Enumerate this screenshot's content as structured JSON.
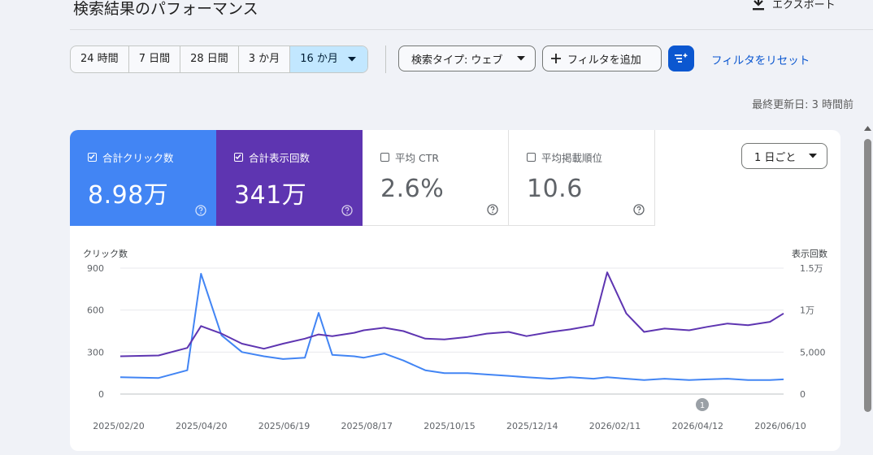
{
  "header": {
    "title": "検索結果のパフォーマンス",
    "export_label": "エクスポート"
  },
  "date_ranges": [
    {
      "label": "24 時間",
      "selected": false
    },
    {
      "label": "7 日間",
      "selected": false
    },
    {
      "label": "28 日間",
      "selected": false
    },
    {
      "label": "3 か月",
      "selected": false
    },
    {
      "label": "16 か月",
      "selected": true
    }
  ],
  "filters": {
    "search_type": "検索タイプ: ウェブ",
    "add_filter": "フィルタを追加",
    "reset": "フィルタをリセット"
  },
  "last_updated": "最終更新日: 3 時間前",
  "metrics": [
    {
      "label": "合計クリック数",
      "value": "8.98万",
      "checked": true,
      "color": "#4285f4"
    },
    {
      "label": "合計表示回数",
      "value": "341万",
      "checked": true,
      "color": "#5e35b1"
    },
    {
      "label": "平均 CTR",
      "value": "2.6%",
      "checked": false
    },
    {
      "label": "平均掲載順位",
      "value": "10.6",
      "checked": false
    }
  ],
  "granularity": "1 日ごと",
  "colors": {
    "accent": "#0b57d0",
    "clicks": "#4285f4",
    "impressions": "#5e35b1",
    "selected_range": "#c2e7ff"
  },
  "annotation_marker": "1",
  "chart_data": {
    "type": "line",
    "ylabel_left": "クリック数",
    "ylabel_right": "表示回数",
    "y_left_ticks": [
      "900",
      "600",
      "300",
      "0"
    ],
    "y_right_ticks": [
      "1.5万",
      "1万",
      "5,000",
      "0"
    ],
    "ylim_left": [
      0,
      900
    ],
    "ylim_right": [
      0,
      15000
    ],
    "x_tick_labels": [
      "2025/02/20",
      "2025/04/20",
      "2025/06/19",
      "2025/08/17",
      "2025/10/15",
      "2025/12/14",
      "2026/02/11",
      "2026/04/12",
      "2026/06/10"
    ],
    "x": [
      "2025/02/20",
      "2025/03/20",
      "2025/04/10",
      "2025/04/20",
      "2025/05/05",
      "2025/05/20",
      "2025/06/05",
      "2025/06/19",
      "2025/07/05",
      "2025/07/15",
      "2025/07/25",
      "2025/08/10",
      "2025/08/17",
      "2025/09/01",
      "2025/09/15",
      "2025/10/01",
      "2025/10/15",
      "2025/11/01",
      "2025/11/15",
      "2025/12/01",
      "2025/12/14",
      "2026/01/01",
      "2026/01/15",
      "2026/02/01",
      "2026/02/11",
      "2026/02/25",
      "2026/03/10",
      "2026/03/25",
      "2026/04/12",
      "2026/04/25",
      "2026/05/10",
      "2026/05/25",
      "2026/06/10",
      "2026/06/20"
    ],
    "series": [
      {
        "name": "合計クリック数",
        "axis": "left",
        "color": "#4285f4",
        "values": [
          120,
          115,
          170,
          860,
          420,
          300,
          270,
          250,
          260,
          580,
          280,
          270,
          260,
          290,
          240,
          170,
          150,
          150,
          140,
          130,
          120,
          110,
          120,
          110,
          120,
          110,
          100,
          110,
          100,
          105,
          110,
          100,
          100,
          105
        ]
      },
      {
        "name": "合計表示回数",
        "axis": "right",
        "color": "#5e35b1",
        "values": [
          4500,
          4600,
          5500,
          8100,
          7200,
          6000,
          5400,
          6000,
          6600,
          7100,
          6900,
          7300,
          7600,
          7900,
          7500,
          6600,
          6500,
          6800,
          7200,
          7400,
          6900,
          7400,
          7700,
          8200,
          14500,
          9600,
          7400,
          7800,
          7600,
          8000,
          8400,
          8200,
          8600,
          9600
        ]
      }
    ],
    "grid": true
  }
}
